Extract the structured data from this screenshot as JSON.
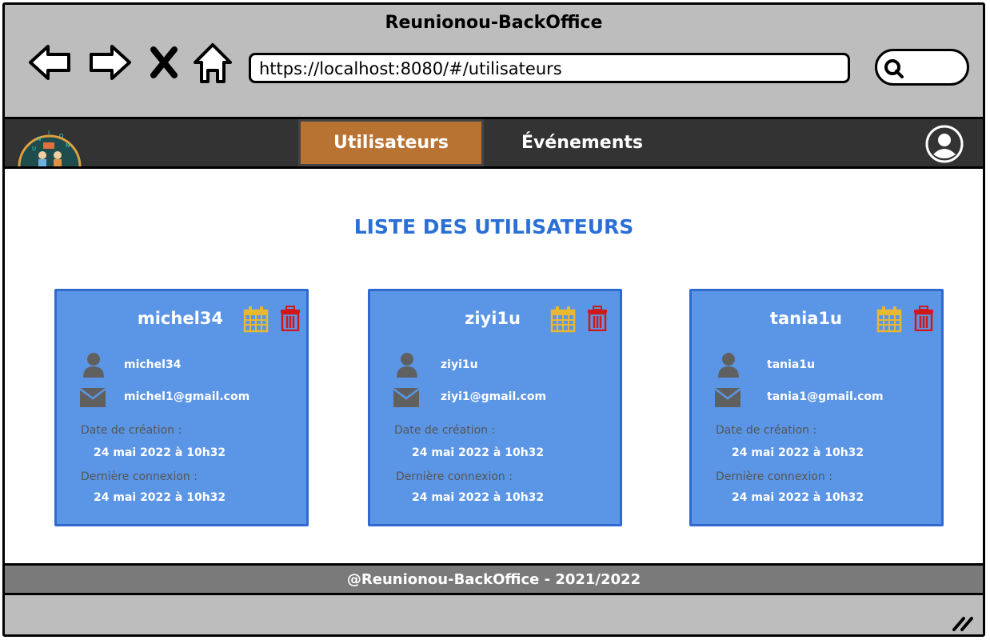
{
  "window": {
    "title": "Reunionou-BackOffice"
  },
  "browser": {
    "url": "https://localhost:8080/#/utilisateurs",
    "icons": [
      "back-arrow-icon",
      "forward-arrow-icon",
      "close-icon",
      "home-icon",
      "search-icon"
    ]
  },
  "navbar": {
    "tabs": [
      {
        "label": "Utilisateurs",
        "active": true
      },
      {
        "label": "Événements",
        "active": false
      }
    ],
    "accent": "#b87333",
    "background": "#333333"
  },
  "main": {
    "title": "LISTE DES UTILISATEURS",
    "title_color": "#2a6fd6",
    "card_color": "#5b96e6",
    "users": [
      {
        "username": "michel34",
        "login": "michel34",
        "email": "michel1@gmail.com",
        "created_label": "Date de création :",
        "created": "24 mai 2022 à 10h32",
        "last_label": "Dernière connexion :",
        "last": "24 mai 2022 à 10h32"
      },
      {
        "username": "ziyi1u",
        "login": "ziyi1u",
        "email": "ziyi1@gmail.com",
        "created_label": "Date de création :",
        "created": "24 mai 2022 à 10h32",
        "last_label": "Dernière connexion :",
        "last": "24 mai 2022 à 10h32"
      },
      {
        "username": "tania1u",
        "login": "tania1u",
        "email": "tania1@gmail.com",
        "created_label": "Date de création :",
        "created": "24 mai 2022 à 10h32",
        "last_label": "Dernière connexion :",
        "last": "24 mai 2022 à 10h32"
      }
    ]
  },
  "footer": {
    "text": "@Reunionou-BackOffice - 2021/2022"
  }
}
